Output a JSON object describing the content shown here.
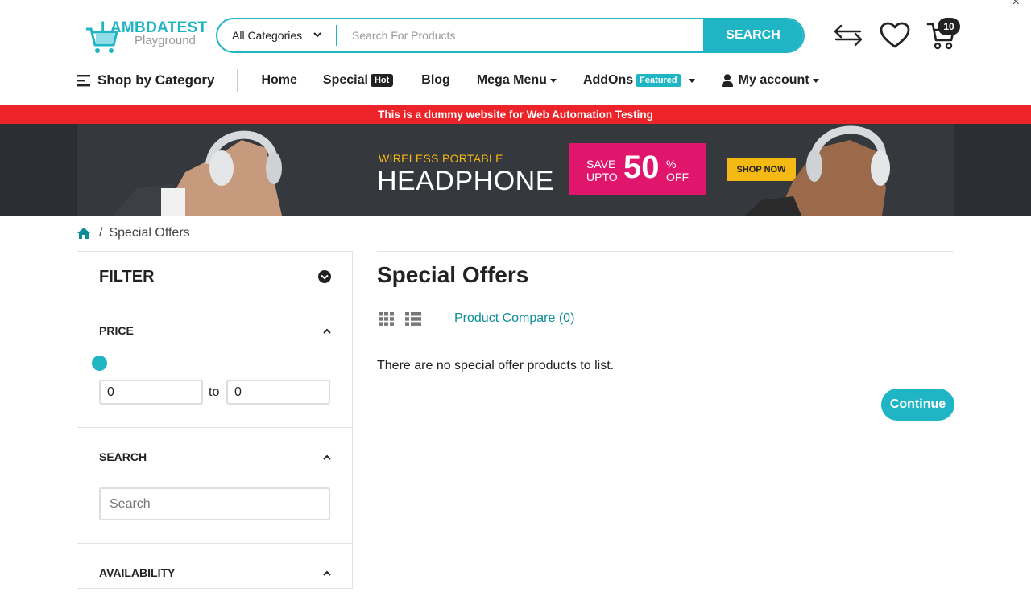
{
  "header": {
    "logo_main": "LAMBDATEST",
    "logo_sub": "Playground",
    "category_select": "All Categories",
    "search_placeholder": "Search For Products",
    "search_button": "SEARCH",
    "cart_count": "10",
    "icons": [
      "compare-arrows-icon",
      "heart-icon",
      "cart-icon"
    ],
    "close_glyph": "×"
  },
  "nav": {
    "shop_by_category": "Shop by Category",
    "home": "Home",
    "special": "Special",
    "special_tag": "Hot",
    "blog": "Blog",
    "mega_menu": "Mega Menu",
    "addons": "AddOns",
    "addons_tag": "Featured",
    "my_account": "My account"
  },
  "notice": "This is a dummy website for Web Automation Testing",
  "promo": {
    "subtitle": "WIRELESS PORTABLE",
    "title": "HEADPHONE",
    "save_line1": "SAVE",
    "save_line2": "UPTO",
    "discount": "50",
    "percent": "%",
    "off": "OFF",
    "cta": "SHOP NOW"
  },
  "breadcrumb": {
    "separator": "/",
    "current": "Special Offers"
  },
  "filter": {
    "title": "FILTER",
    "price_label": "PRICE",
    "price_min": "0",
    "price_to": "to",
    "price_max": "0",
    "search_label": "SEARCH",
    "search_placeholder": "Search",
    "availability_label": "AVAILABILITY"
  },
  "main": {
    "title": "Special Offers",
    "compare_link": "Product Compare (0)",
    "empty_message": "There are no special offer products to list.",
    "continue_button": "Continue"
  },
  "colors": {
    "accent": "#20b5c4",
    "notice_bg": "#ec2429",
    "hot_tag": "#222222",
    "featured_tag": "#20b5c4",
    "promo_bg": "#35383d",
    "promo_yellow": "#f5b914",
    "promo_pink": "#e0156c"
  }
}
